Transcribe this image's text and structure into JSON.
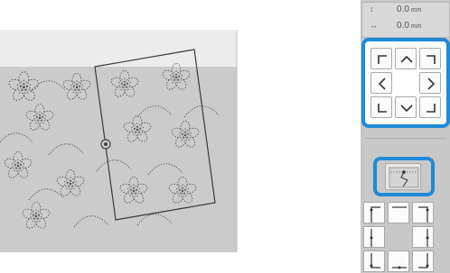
{
  "readout": {
    "height_value": "0.0",
    "height_unit": "mm",
    "width_value": "0.0",
    "width_unit": "mm"
  },
  "icons": {
    "height_icon": "vertical-arrow-icon",
    "width_icon": "horizontal-arrow-icon",
    "move_buttons": [
      "corner-top-left-icon",
      "arrow-up-icon",
      "corner-top-right-icon",
      "arrow-left-icon",
      "arrow-right-icon",
      "corner-bottom-left-icon",
      "arrow-down-icon",
      "corner-bottom-right-icon"
    ],
    "start_point_button": "start-point-stitch-icon"
  },
  "colors": {
    "highlight": "#1f8ad6",
    "fabric": "#cbcbcb",
    "hoop_top": "#ececec",
    "frame": "#555555"
  }
}
